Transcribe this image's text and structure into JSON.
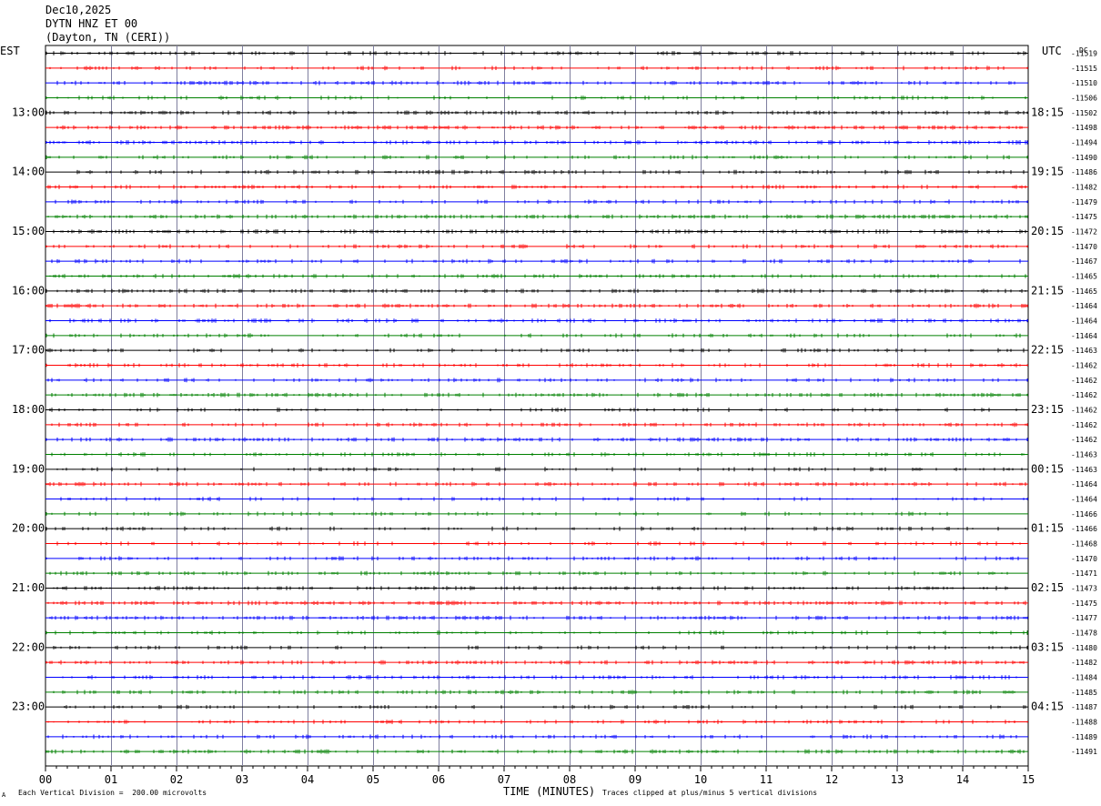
{
  "header": {
    "date": "Dec10,2025",
    "station": "DYTN HNZ ET 00",
    "location": "(Dayton, TN (CERI))"
  },
  "left_timezone": "EST",
  "right_timezone": "UTC",
  "dc_label": "DC",
  "footer": {
    "mark": "A",
    "scale_note": "Each Vertical Division =  200.00 microvolts",
    "xlabel": "TIME (MINUTES)",
    "clip_note": "Traces clipped at plus/minus 5 vertical divisions"
  },
  "colors": {
    "trace_cycle": [
      "#000000",
      "#ff0000",
      "#0000ff",
      "#008000"
    ],
    "grid": "#7f7f9f"
  },
  "chart_data": {
    "type": "line",
    "title": "DYTN HNZ ET 00",
    "xlabel": "TIME (MINUTES)",
    "xlim": [
      0,
      15
    ],
    "x_ticks": [
      "00",
      "01",
      "02",
      "03",
      "04",
      "05",
      "06",
      "07",
      "08",
      "09",
      "10",
      "11",
      "12",
      "13",
      "14",
      "15"
    ],
    "left_hour_labels": [
      "13:00",
      "14:00",
      "15:00",
      "16:00",
      "17:00",
      "18:00",
      "19:00",
      "20:00",
      "21:00",
      "22:00",
      "23:00"
    ],
    "right_hour_labels": [
      "18:15",
      "19:15",
      "20:15",
      "21:15",
      "22:15",
      "23:15",
      "00:15",
      "01:15",
      "02:15",
      "03:15",
      "04:15"
    ],
    "dc_offsets": [
      "-11519",
      "-11515",
      "-11510",
      "-11506",
      "-11502",
      "-11498",
      "-11494",
      "-11490",
      "-11486",
      "-11482",
      "-11479",
      "-11475",
      "-11472",
      "-11470",
      "-11467",
      "-11465",
      "-11465",
      "-11464",
      "-11464",
      "-11464",
      "-11463",
      "-11462",
      "-11462",
      "-11462",
      "-11462",
      "-11462",
      "-11462",
      "-11463",
      "-11463",
      "-11464",
      "-11464",
      "-11466",
      "-11466",
      "-11468",
      "-11470",
      "-11471",
      "-11473",
      "-11475",
      "-11477",
      "-11478",
      "-11480",
      "-11482",
      "-11484",
      "-11485",
      "-11487",
      "-11488",
      "-11489",
      "-11491"
    ],
    "traces": 48,
    "first_labeled_trace": 4,
    "traces_per_hour": 4
  }
}
